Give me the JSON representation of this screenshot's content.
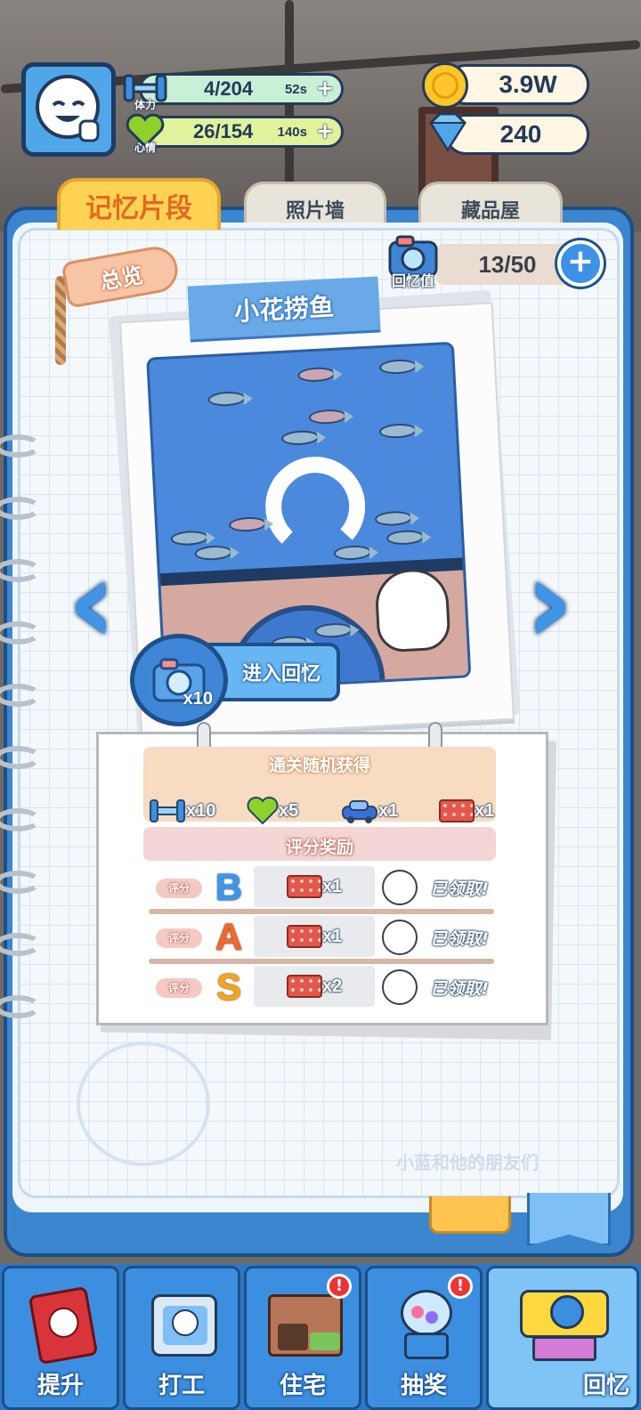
{
  "player": {
    "stamina": {
      "label": "体力",
      "value": "4/204",
      "timer": "52s"
    },
    "mood": {
      "label": "心情",
      "value": "26/154",
      "timer": "140s"
    },
    "coins": "3.9W",
    "diamonds": "240"
  },
  "tabs": [
    {
      "label": "记忆片段",
      "active": true
    },
    {
      "label": "照片墙",
      "active": false
    },
    {
      "label": "藏品屋",
      "active": false
    }
  ],
  "overview_tag": "总览",
  "memory_value": {
    "label": "回忆值",
    "value": "13/50"
  },
  "memory": {
    "title": "小花捞鱼",
    "enter_label": "进入回忆",
    "cost": "x10"
  },
  "clear_rewards": {
    "title": "通关随机获得",
    "items": [
      {
        "icon": "dumbbell-icon",
        "count": "x10"
      },
      {
        "icon": "heart-icon",
        "count": "x5"
      },
      {
        "icon": "blue-car-icon",
        "count": "x1"
      },
      {
        "icon": "red-brick-icon",
        "count": "x1"
      }
    ]
  },
  "score_rewards": {
    "title": "评分奖励",
    "label": "评分",
    "rows": [
      {
        "grade": "B",
        "grade_color": "#3d97e6",
        "reward": "x1",
        "status": "已领取!"
      },
      {
        "grade": "A",
        "grade_color": "#ef6a2c",
        "reward": "x1",
        "status": "已领取!"
      },
      {
        "grade": "S",
        "grade_color": "#f2a520",
        "reward": "x2",
        "status": "已领取!"
      }
    ]
  },
  "watermark": "小蓝和他的朋友们",
  "bottom_nav": [
    {
      "label": "提升",
      "badge": ""
    },
    {
      "label": "打工",
      "badge": ""
    },
    {
      "label": "住宅",
      "badge": "!"
    },
    {
      "label": "抽奖",
      "badge": "!"
    },
    {
      "label": "回忆",
      "badge": "",
      "active": true
    }
  ]
}
